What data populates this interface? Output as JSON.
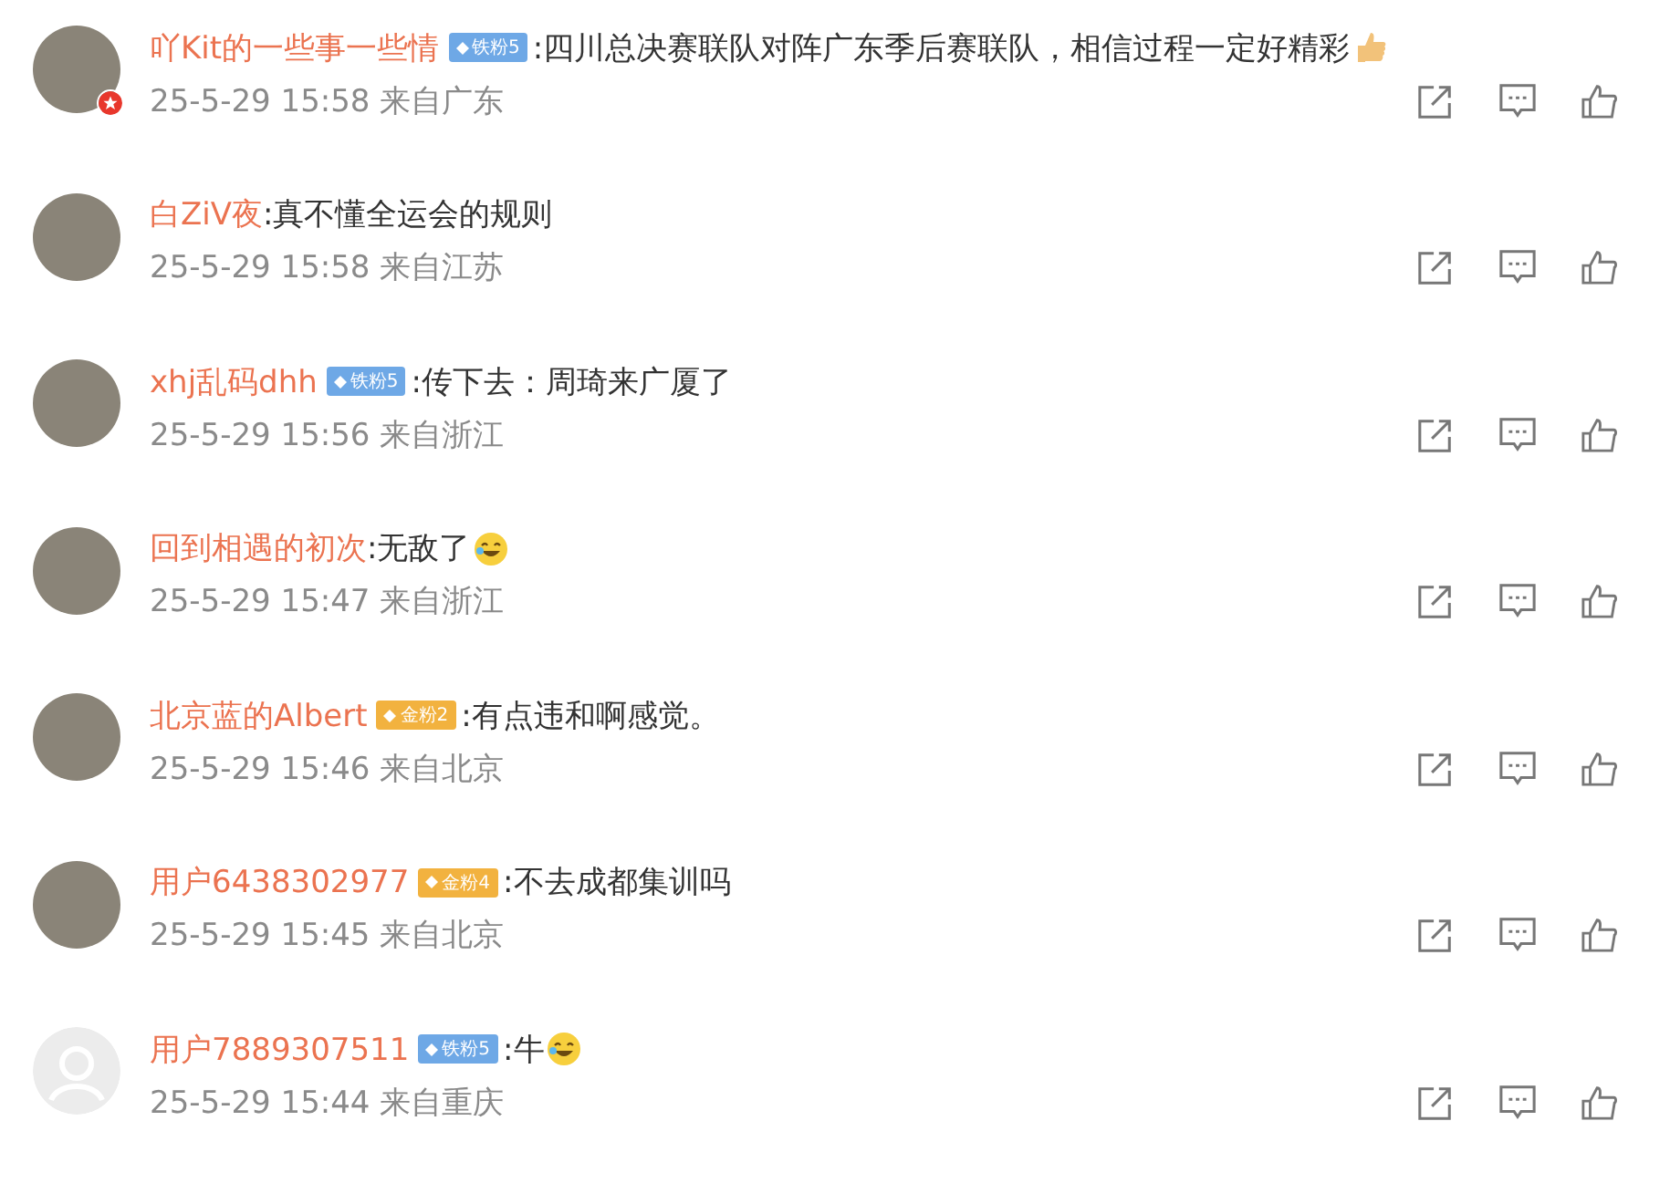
{
  "comments": [
    {
      "avatar": {
        "kind": "photo"
      },
      "verified": true,
      "name": "吖Kit的一些事一些情",
      "badge": {
        "kind": "iron",
        "label": "铁粉5"
      },
      "text": ":四川总决赛联队对阵广东季后赛联队，相信过程一定好精彩",
      "emoji": {
        "kind": "thumbs"
      },
      "time": "25-5-29 15:58 来自广东"
    },
    {
      "avatar": {
        "kind": "photo"
      },
      "verified": false,
      "name": "白ZiV夜",
      "text": ":真不懂全运会的规则",
      "time": "25-5-29 15:58 来自江苏"
    },
    {
      "avatar": {
        "kind": "photo"
      },
      "verified": false,
      "name": "xhj乱码dhh",
      "badge": {
        "kind": "iron",
        "label": "铁粉5"
      },
      "text": ":传下去：周琦来广厦了",
      "time": "25-5-29 15:56 来自浙江"
    },
    {
      "avatar": {
        "kind": "photo"
      },
      "verified": false,
      "name": "回到相遇的初次",
      "text": ":无敌了",
      "emoji": {
        "kind": "laugh"
      },
      "time": "25-5-29 15:47 来自浙江"
    },
    {
      "avatar": {
        "kind": "photo"
      },
      "verified": false,
      "name": "北京蓝的Albert",
      "badge": {
        "kind": "gold",
        "label": "金粉2"
      },
      "text": ":有点违和啊感觉。",
      "time": "25-5-29 15:46 来自北京"
    },
    {
      "avatar": {
        "kind": "photo"
      },
      "verified": false,
      "name": "用户6438302977",
      "badge": {
        "kind": "gold",
        "label": "金粉4"
      },
      "text": ":不去成都集训吗",
      "time": "25-5-29 15:45 来自北京"
    },
    {
      "avatar": {
        "kind": "default"
      },
      "verified": false,
      "name": "用户7889307511",
      "badge": {
        "kind": "iron",
        "label": "铁粉5"
      },
      "text": ":牛",
      "emoji": {
        "kind": "laugh"
      },
      "time": "25-5-29 15:44 来自重庆"
    }
  ]
}
